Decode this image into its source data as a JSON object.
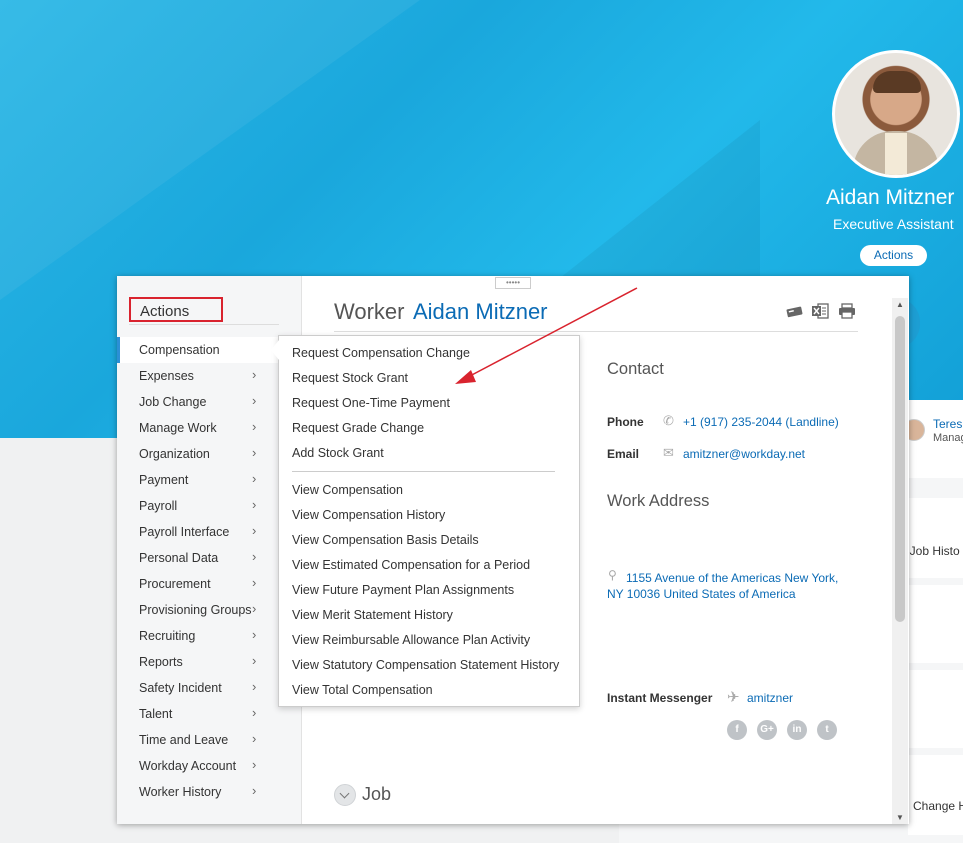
{
  "profile": {
    "name": "Aidan Mitzner",
    "title": "Executive Assistant",
    "actions_label": "Actions"
  },
  "background": {
    "teres": "Teres",
    "manag": "Manag",
    "job_hist": ", Job Histo",
    "change_h": "Change H"
  },
  "actions_menu": {
    "title": "Actions",
    "items": [
      {
        "label": "Compensation"
      },
      {
        "label": "Expenses"
      },
      {
        "label": "Job Change"
      },
      {
        "label": "Manage Work"
      },
      {
        "label": "Organization"
      },
      {
        "label": "Payment"
      },
      {
        "label": "Payroll"
      },
      {
        "label": "Payroll Interface"
      },
      {
        "label": "Personal Data"
      },
      {
        "label": "Procurement"
      },
      {
        "label": "Provisioning Groups"
      },
      {
        "label": "Recruiting"
      },
      {
        "label": "Reports"
      },
      {
        "label": "Safety Incident"
      },
      {
        "label": "Talent"
      },
      {
        "label": "Time and Leave"
      },
      {
        "label": "Workday Account"
      },
      {
        "label": "Worker History"
      }
    ],
    "chevron": "›"
  },
  "submenu": {
    "group1": [
      "Request Compensation Change",
      "Request Stock Grant",
      "Request One-Time Payment",
      "Request Grade Change",
      "Add Stock Grant"
    ],
    "group2": [
      "View Compensation",
      "View Compensation History",
      "View Compensation Basis Details",
      "View Estimated Compensation for a Period",
      "View Future Payment Plan Assignments",
      "View Merit Statement History",
      "View Reimbursable Allowance Plan Activity",
      "View Statutory Compensation Statement History",
      "View Total Compensation"
    ]
  },
  "worker": {
    "label": "Worker",
    "name": "Aidan Mitzner",
    "grip": "•••••",
    "icons": [
      "card-icon",
      "excel-icon",
      "print-icon"
    ]
  },
  "contact": {
    "heading": "Contact",
    "phone_label": "Phone",
    "phone": "+1 (917) 235-2044 (Landline)",
    "email_label": "Email",
    "email": "amitzner@workday.net",
    "work_address_heading": "Work Address",
    "address_line1": "1155 Avenue of the Americas New York,",
    "address_line2": "NY 10036 United States of America",
    "im_label": "Instant Messenger",
    "im_value": "amitzner",
    "social": [
      "f",
      "G+",
      "in",
      "t"
    ]
  },
  "job": {
    "heading": "Job"
  },
  "colors": {
    "accent": "#0b6bb5",
    "highlight_box": "#d9232e",
    "hero": "#1fb3e6"
  }
}
